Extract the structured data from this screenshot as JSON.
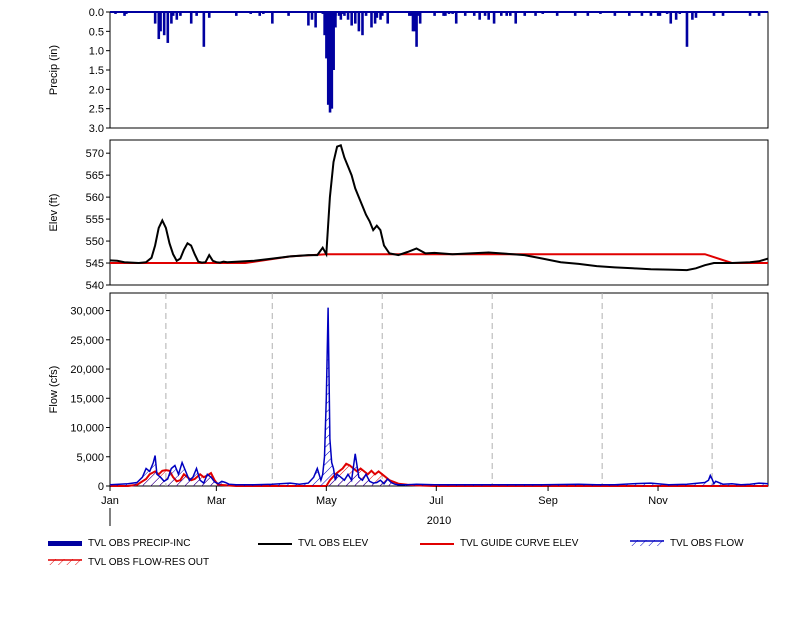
{
  "chart_data": [
    {
      "type": "bar",
      "ylabel": "Precip (in)",
      "ylim": [
        3.0,
        0.0
      ],
      "y_inverted": true,
      "yticks": [
        "0.0",
        "0.5",
        "1.0",
        "1.5",
        "2.0",
        "2.5",
        "3.0"
      ],
      "series": [
        {
          "name": "TVL OBS PRECIP-INC",
          "color": "#0000a0",
          "x_days": [
            3,
            8,
            9,
            25,
            27,
            28,
            30,
            32,
            34,
            35,
            37,
            39,
            45,
            48,
            52,
            55,
            70,
            78,
            83,
            85,
            90,
            99,
            110,
            112,
            114,
            118,
            122,
            124,
            125,
            127,
            128,
            129,
            130,
            132,
            134,
            136,
            138,
            140,
            142,
            145,
            147,
            148,
            150,
            151,
            154,
            166,
            167,
            168,
            169,
            170,
            171,
            172,
            180,
            185,
            186,
            188,
            190,
            192,
            197,
            202,
            205,
            208,
            210,
            213,
            217,
            220,
            222,
            225,
            230,
            236,
            240,
            248,
            258,
            265,
            272,
            280,
            288,
            295,
            300,
            304,
            305,
            309,
            311,
            314,
            316,
            320,
            323,
            325,
            335,
            340,
            355,
            360
          ],
          "values": [
            0.05,
            0.1,
            0.05,
            0.3,
            0.7,
            0.5,
            0.6,
            0.8,
            0.3,
            0.1,
            0.2,
            0.1,
            0.3,
            0.1,
            0.9,
            0.15,
            0.1,
            0.05,
            0.1,
            0.05,
            0.3,
            0.1,
            0.35,
            0.2,
            0.4,
            0.05,
            0.3,
            0.05,
            0.1,
            0.1,
            0.2,
            0.05,
            0.1,
            0.2,
            0.35,
            0.3,
            0.5,
            0.6,
            0.1,
            0.4,
            0.3,
            0.15,
            0.2,
            0.1,
            0.3,
            0.1,
            0.1,
            0.5,
            0.5,
            0.9,
            0.1,
            0.3,
            0.1,
            0.1,
            0.1,
            0.05,
            0.05,
            0.3,
            0.1,
            0.1,
            0.2,
            0.1,
            0.2,
            0.3,
            0.1,
            0.1,
            0.1,
            0.3,
            0.1,
            0.1,
            0.05,
            0.1,
            0.1,
            0.1,
            0.05,
            0.1,
            0.1,
            0.1,
            0.1,
            0.1,
            0.1,
            0.05,
            0.3,
            0.2,
            0.05,
            0.9,
            0.2,
            0.15,
            0.1,
            0.1,
            0.1,
            0.1
          ],
          "bar_highlight_days": [
            119,
            120,
            121,
            122,
            123,
            124,
            125
          ],
          "bar_highlight_values": [
            0.6,
            1.2,
            2.4,
            2.6,
            2.5,
            1.5,
            0.4
          ]
        }
      ]
    },
    {
      "type": "line",
      "ylabel": "Elev (ft)",
      "ylim": [
        540,
        573
      ],
      "yticks": [
        "540",
        "545",
        "550",
        "555",
        "560",
        "565",
        "570"
      ],
      "series": [
        {
          "name": "TVL OBS ELEV",
          "color": "#000000",
          "x_days": [
            0,
            4,
            8,
            12,
            16,
            20,
            23,
            25,
            27,
            29,
            31,
            33,
            35,
            37,
            39,
            41,
            43,
            45,
            47,
            49,
            51,
            53,
            55,
            57,
            59,
            61,
            63,
            65,
            70,
            80,
            90,
            100,
            110,
            115,
            118,
            120,
            122,
            124,
            126,
            128,
            130,
            132,
            134,
            136,
            138,
            140,
            142,
            144,
            146,
            148,
            150,
            152,
            155,
            160,
            165,
            170,
            175,
            180,
            190,
            200,
            210,
            220,
            230,
            240,
            250,
            260,
            270,
            280,
            290,
            300,
            310,
            320,
            325,
            330,
            335,
            340,
            345,
            350,
            355,
            360,
            365
          ],
          "values": [
            545.6,
            545.5,
            545.2,
            545.1,
            545.0,
            545.2,
            546.2,
            549.0,
            553.0,
            554.7,
            553.0,
            549.5,
            547.0,
            545.5,
            546.0,
            548.0,
            549.5,
            549.0,
            547.0,
            545.3,
            545.1,
            545.2,
            546.8,
            545.5,
            545.2,
            545.1,
            545.3,
            545.2,
            545.3,
            545.5,
            546.0,
            546.5,
            546.8,
            546.8,
            548.5,
            547.0,
            560.0,
            568.0,
            571.5,
            571.8,
            569.0,
            567.0,
            565.0,
            562.0,
            560.0,
            558.0,
            556.0,
            554.5,
            552.5,
            553.5,
            552.5,
            549.0,
            547.2,
            546.8,
            547.5,
            548.3,
            547.2,
            547.3,
            547.0,
            547.2,
            547.4,
            547.1,
            546.8,
            546.0,
            545.2,
            544.8,
            544.3,
            544.0,
            543.8,
            543.6,
            543.5,
            543.4,
            543.8,
            544.5,
            545.0,
            545.0,
            545.0,
            545.1,
            545.2,
            545.4,
            546.0
          ]
        },
        {
          "name": "TVL GUIDE CURVE ELEV",
          "color": "#e00000",
          "x_days": [
            0,
            75,
            100,
            120,
            330,
            345,
            365
          ],
          "values": [
            545.0,
            545.0,
            546.5,
            547.0,
            547.0,
            545.0,
            545.0
          ]
        }
      ]
    },
    {
      "type": "area",
      "ylabel": "Flow (cfs)",
      "xlabel": "2010",
      "ylim": [
        0,
        33000
      ],
      "yticks": [
        "0",
        "5,000",
        "10,000",
        "15,000",
        "20,000",
        "25,000",
        "30,000"
      ],
      "xticks": [
        "Jan",
        "Mar",
        "May",
        "Jul",
        "Sep",
        "Nov"
      ],
      "xtick_days": [
        0,
        59,
        120,
        181,
        243,
        304
      ],
      "grid_days": [
        31,
        90,
        151,
        212,
        273,
        334
      ],
      "series": [
        {
          "name": "TVL OBS FLOW",
          "color": "#0000c0",
          "x_days": [
            0,
            5,
            10,
            15,
            18,
            20,
            22,
            24,
            25,
            26,
            28,
            30,
            32,
            34,
            36,
            38,
            40,
            42,
            44,
            46,
            48,
            50,
            52,
            54,
            56,
            58,
            60,
            62,
            64,
            66,
            70,
            80,
            90,
            100,
            105,
            110,
            113,
            115,
            117,
            118,
            119,
            120,
            121,
            122,
            123,
            124,
            125,
            126,
            128,
            130,
            132,
            134,
            136,
            138,
            140,
            142,
            144,
            146,
            148,
            150,
            152,
            154,
            156,
            158,
            160,
            165,
            170,
            180,
            200,
            220,
            240,
            260,
            270,
            280,
            290,
            300,
            310,
            320,
            330,
            332,
            333,
            334,
            335,
            336,
            340,
            345,
            350,
            355,
            360,
            365
          ],
          "values": [
            200,
            300,
            400,
            600,
            1500,
            3000,
            2500,
            4000,
            5200,
            2000,
            1500,
            800,
            1200,
            3000,
            3500,
            2000,
            4000,
            2500,
            1000,
            1500,
            3000,
            1000,
            500,
            2000,
            1500,
            700,
            400,
            800,
            600,
            300,
            200,
            200,
            300,
            500,
            300,
            500,
            1500,
            3000,
            1000,
            2000,
            5000,
            15000,
            30500,
            8000,
            4000,
            3000,
            1000,
            2000,
            1500,
            1000,
            2000,
            1000,
            5500,
            1500,
            1000,
            2000,
            800,
            500,
            600,
            1000,
            400,
            1200,
            600,
            300,
            200,
            200,
            300,
            200,
            200,
            200,
            200,
            300,
            200,
            200,
            400,
            500,
            200,
            300,
            600,
            1000,
            1800,
            1200,
            400,
            800,
            300,
            400,
            200,
            300,
            500,
            400
          ]
        },
        {
          "name": "TVL OBS FLOW-RES OUT",
          "color": "#e00000",
          "x_days": [
            0,
            10,
            15,
            18,
            20,
            22,
            25,
            27,
            29,
            31,
            33,
            35,
            37,
            39,
            41,
            43,
            45,
            47,
            50,
            52,
            54,
            56,
            58,
            60,
            65,
            70,
            80,
            90,
            100,
            110,
            118,
            120,
            122,
            125,
            127,
            129,
            131,
            133,
            135,
            137,
            139,
            141,
            143,
            145,
            147,
            149,
            151,
            153,
            155,
            160,
            165,
            170,
            180,
            200,
            240,
            280,
            320,
            365
          ],
          "values": [
            0,
            0,
            200,
            800,
            1200,
            2000,
            2500,
            2000,
            2600,
            2700,
            2600,
            1500,
            800,
            1000,
            2000,
            1500,
            1000,
            1200,
            2000,
            1500,
            1800,
            2200,
            1000,
            200,
            100,
            0,
            0,
            0,
            0,
            0,
            0,
            0,
            1000,
            2000,
            2500,
            3000,
            3800,
            3500,
            3000,
            2500,
            3000,
            2500,
            2000,
            2600,
            2000,
            2500,
            2000,
            1500,
            1000,
            400,
            200,
            100,
            0,
            0,
            0,
            0,
            0,
            0
          ]
        }
      ]
    }
  ],
  "legend": [
    {
      "label": "TVL OBS PRECIP-INC",
      "style": "thick-bar",
      "color": "#0000a0"
    },
    {
      "label": "TVL OBS ELEV",
      "style": "line",
      "color": "#000000"
    },
    {
      "label": "TVL GUIDE CURVE ELEV",
      "style": "line",
      "color": "#e00000"
    },
    {
      "label": "TVL OBS FLOW",
      "style": "hatched",
      "color": "#0000c0"
    },
    {
      "label": "TVL OBS FLOW-RES OUT",
      "style": "hatched",
      "color": "#e00000"
    }
  ]
}
